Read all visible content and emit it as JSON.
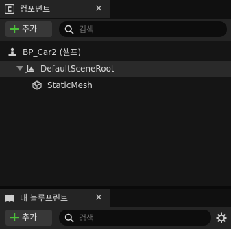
{
  "components_panel": {
    "tab_label": "컴포넌트",
    "close_glyph": "×",
    "add_label": "추가",
    "search_placeholder": "검색",
    "tree": [
      {
        "label": "BP_Car2 (셀프)",
        "icon": "self-actor-icon"
      },
      {
        "label": "DefaultSceneRoot",
        "icon": "scene-root-icon",
        "expanded": true
      },
      {
        "label": "StaticMesh",
        "icon": "static-mesh-icon"
      }
    ]
  },
  "blueprint_panel": {
    "tab_label": "내 블루프린트",
    "close_glyph": "×",
    "add_label": "추가",
    "search_placeholder": "검색"
  },
  "colors": {
    "accent_green": "#4cbf3a",
    "panel_bg": "#242424",
    "tree_bg": "#151515"
  }
}
